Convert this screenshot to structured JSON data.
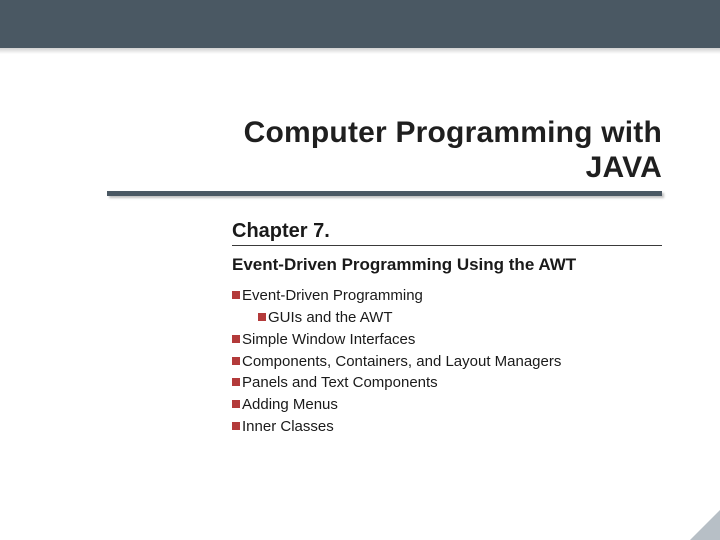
{
  "title": {
    "line1": "Computer Programming with",
    "line2": "JAVA"
  },
  "chapter": "Chapter 7.",
  "subtitle": "Event-Driven Programming Using the AWT",
  "items": [
    {
      "level": 1,
      "text": "Event-Driven Programming"
    },
    {
      "level": 2,
      "text": "GUIs and the AWT"
    },
    {
      "level": 1,
      "text": "Simple Window Interfaces"
    },
    {
      "level": 1,
      "text": "Components, Containers, and Layout Managers"
    },
    {
      "level": 1,
      "text": "Panels and Text Components"
    },
    {
      "level": 1,
      "text": "Adding Menus"
    },
    {
      "level": 1,
      "text": "Inner Classes"
    }
  ],
  "colors": {
    "bar": "#4a5863",
    "bullet": "#b33a3a"
  }
}
